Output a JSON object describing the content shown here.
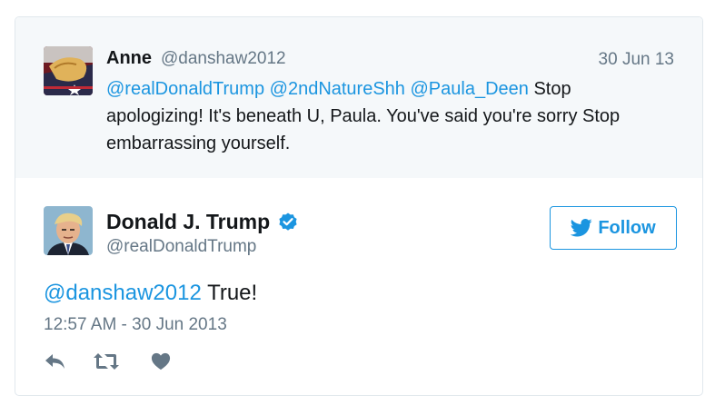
{
  "parent_tweet": {
    "author_name": "Anne",
    "author_handle": "@danshaw2012",
    "date": "30 Jun 13",
    "mentions": [
      "@realDonaldTrump",
      "@2ndNatureShh",
      "@Paula_Deen"
    ],
    "text_line1_rest": "Stop",
    "text_rest": "apologizing! It's beneath U, Paula. You've said you're sorry Stop embarrassing yourself."
  },
  "main_tweet": {
    "author_name": "Donald J. Trump",
    "author_handle": "@realDonaldTrump",
    "verified": true,
    "follow_label": "Follow",
    "reply_mention": "@danshaw2012",
    "text": "True!",
    "timestamp": "12:57 AM - 30 Jun 2013"
  },
  "icons": {
    "verified": "verified-badge-icon",
    "follow": "twitter-bird-icon",
    "reply": "reply-icon",
    "retweet": "retweet-icon",
    "like": "heart-icon"
  },
  "colors": {
    "link": "#1b95e0",
    "muted": "#657786",
    "parent_bg": "#f5f8fa",
    "border": "#e1e8ed",
    "action_icon": "#657786"
  }
}
